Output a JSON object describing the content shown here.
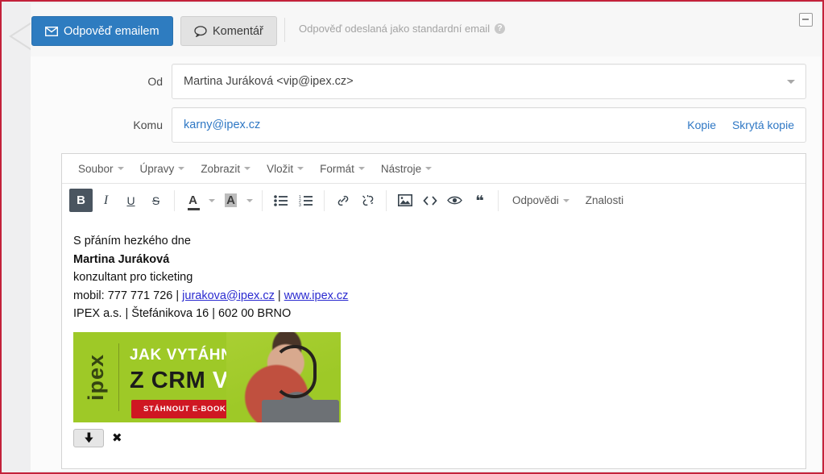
{
  "actions": {
    "reply_email_label": "Odpověď emailem",
    "reply_email_icon": "envelope-icon",
    "comment_label": "Komentář",
    "comment_icon": "speech-bubble-icon",
    "hint_text": "Odpověď odeslaná jako standardní email",
    "hint_icon": "question-mark-icon",
    "collapse_icon": "minimize-window-icon"
  },
  "fields": {
    "from_label": "Od",
    "from_value": "Martina Juráková <vip@ipex.cz>",
    "from_dropdown_icon": "chevron-down-icon",
    "to_label": "Komu",
    "to_value": "karny@ipex.cz",
    "cc_label": "Kopie",
    "bcc_label": "Skrytá kopie"
  },
  "editor": {
    "menu": [
      {
        "label": "Soubor",
        "name": "menu-file"
      },
      {
        "label": "Úpravy",
        "name": "menu-edit"
      },
      {
        "label": "Zobrazit",
        "name": "menu-view"
      },
      {
        "label": "Vložit",
        "name": "menu-insert"
      },
      {
        "label": "Formát",
        "name": "menu-format"
      },
      {
        "label": "Nástroje",
        "name": "menu-tools"
      }
    ],
    "toolbar": {
      "bold": "B",
      "italic": "I",
      "underline": "U",
      "strikethrough": "S",
      "text_color_glyph": "A",
      "background_color_glyph": "A",
      "answers_label": "Odpovědi",
      "knowledge_label": "Znalosti"
    }
  },
  "body": {
    "greeting": "S přáním hezkého dne",
    "name": "Martina Juráková",
    "position": "konzultant pro ticketing",
    "contact_prefix": "mobil: 777 771 726 | ",
    "contact_email": "jurakova@ipex.cz",
    "contact_sep": " | ",
    "contact_web": "www.ipex.cz",
    "address": "IPEX a.s. | Štefánikova 16 | 602 00 BRNO"
  },
  "banner": {
    "logo": "ipex",
    "line1": "JAK VYTÁHNOUT",
    "line2_dark": "Z CRM ",
    "line2_light": "VÍCE",
    "cta": "STÁHNOUT E-BOOK"
  },
  "attachment": {
    "download_icon": "download-arrow-icon",
    "remove_icon": "close-x-icon"
  },
  "colors": {
    "primary_button": "#2e7cc0",
    "banner_green": "#9ec927",
    "banner_cta_red": "#cf1722",
    "link_blue": "#2e77c4",
    "page_border_red": "#c3213a"
  }
}
